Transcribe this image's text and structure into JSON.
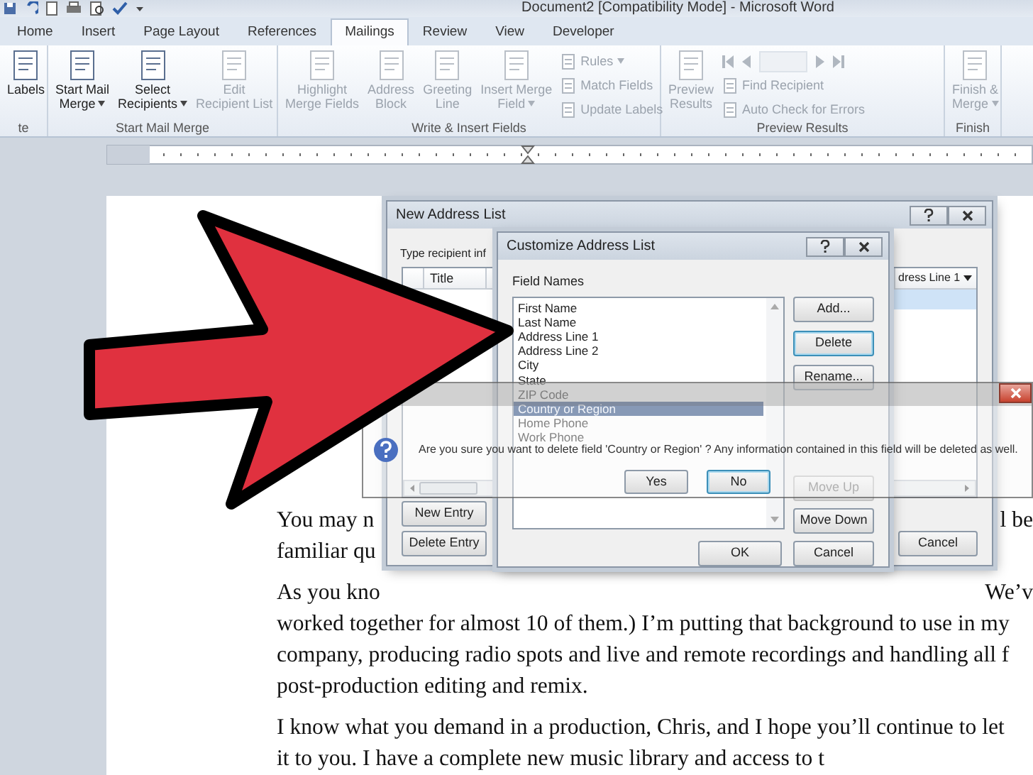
{
  "window": {
    "title": "Document2 [Compatibility Mode]  -  Microsoft Word"
  },
  "ribbon_tabs": [
    {
      "label": "Home",
      "selected": false
    },
    {
      "label": "Insert",
      "selected": false
    },
    {
      "label": "Page Layout",
      "selected": false
    },
    {
      "label": "References",
      "selected": false
    },
    {
      "label": "Mailings",
      "selected": true
    },
    {
      "label": "Review",
      "selected": false
    },
    {
      "label": "View",
      "selected": false
    },
    {
      "label": "Developer",
      "selected": false
    }
  ],
  "ribbon_groups": [
    {
      "label": "te",
      "items": [
        {
          "kind": "large",
          "lines": [
            "Labels"
          ],
          "dropdown": false,
          "disabled": false
        }
      ]
    },
    {
      "label": "Start Mail Merge",
      "items": [
        {
          "kind": "large",
          "lines": [
            "Start Mail",
            "Merge"
          ],
          "dropdown": true,
          "disabled": false
        },
        {
          "kind": "large",
          "lines": [
            "Select",
            "Recipients"
          ],
          "dropdown": true,
          "disabled": false
        },
        {
          "kind": "large",
          "lines": [
            "Edit",
            "Recipient List"
          ],
          "dropdown": false,
          "disabled": true
        }
      ]
    },
    {
      "label": "Write & Insert Fields",
      "items": [
        {
          "kind": "large",
          "lines": [
            "Highlight",
            "Merge Fields"
          ],
          "dropdown": false,
          "disabled": true
        },
        {
          "kind": "large",
          "lines": [
            "Address",
            "Block"
          ],
          "dropdown": false,
          "disabled": true
        },
        {
          "kind": "large",
          "lines": [
            "Greeting",
            "Line"
          ],
          "dropdown": false,
          "disabled": true
        },
        {
          "kind": "large",
          "lines": [
            "Insert Merge",
            "Field"
          ],
          "dropdown": true,
          "disabled": true
        },
        {
          "kind": "stack",
          "rows": [
            {
              "kind": "button",
              "label": "Rules",
              "dropdown": true,
              "disabled": true
            },
            {
              "kind": "button",
              "label": "Match Fields",
              "dropdown": false,
              "disabled": true
            },
            {
              "kind": "button",
              "label": "Update Labels",
              "dropdown": false,
              "disabled": true
            }
          ]
        }
      ]
    },
    {
      "label": "Preview Results",
      "items": [
        {
          "kind": "large",
          "lines": [
            "Preview",
            "Results"
          ],
          "dropdown": false,
          "disabled": true
        },
        {
          "kind": "stack",
          "rows": [
            {
              "kind": "nav",
              "disabled": true
            },
            {
              "kind": "button",
              "label": "Find Recipient",
              "dropdown": false,
              "disabled": true
            },
            {
              "kind": "button",
              "label": "Auto Check for Errors",
              "dropdown": false,
              "disabled": true
            }
          ]
        }
      ]
    },
    {
      "label": "Finish",
      "items": [
        {
          "kind": "large",
          "lines": [
            "Finish &",
            "Merge"
          ],
          "dropdown": true,
          "disabled": true
        }
      ]
    }
  ],
  "document": {
    "paragraphs": [
      {
        "lines": [
          {
            "left": "You may n",
            "right": "l be"
          },
          {
            "left": "familiar qu"
          }
        ]
      },
      {
        "lines": [
          {
            "left": "As you kno",
            "right": "We’v"
          },
          {
            "left": "worked together for almost 10 of them.) I’m putting that background to use in my"
          },
          {
            "left": "company, producing radio spots and live and remote recordings and handling all f"
          },
          {
            "left": "post-production editing and remix."
          }
        ]
      },
      {
        "lines": [
          {
            "left": "I know what you demand in a production, Chris, and I hope you’ll continue to let"
          },
          {
            "left": "it to you. I have a complete new music library and access to t"
          }
        ]
      }
    ]
  },
  "new_address_list": {
    "title": "New Address List",
    "prompt": "Type recipient inf",
    "table": {
      "columns": [
        "Title",
        "dress Line 1"
      ],
      "rows": [
        {
          "selected": true
        }
      ]
    },
    "buttons": [
      "New Entry",
      "Delete Entry",
      "Cancel"
    ]
  },
  "customize_address_list": {
    "title": "Customize Address List",
    "list_label": "Field Names",
    "fields": [
      {
        "name": "First Name",
        "selected": false
      },
      {
        "name": "Last Name",
        "selected": false
      },
      {
        "name": "Address Line 1",
        "selected": false
      },
      {
        "name": "Address Line 2",
        "selected": false
      },
      {
        "name": "City",
        "selected": false
      },
      {
        "name": "State",
        "selected": false
      },
      {
        "name": "ZIP Code",
        "selected": false
      },
      {
        "name": "Country or Region",
        "selected": true
      },
      {
        "name": "Home Phone",
        "selected": false
      },
      {
        "name": "Work Phone",
        "selected": false
      }
    ],
    "side_buttons": [
      {
        "label": "Add...",
        "focused": false,
        "disabled": false
      },
      {
        "label": "Delete",
        "focused": true,
        "disabled": false
      },
      {
        "label": "Rename...",
        "focused": false,
        "disabled": false
      },
      {
        "label": "Move Up",
        "focused": false,
        "disabled": true
      },
      {
        "label": "Move Down",
        "focused": false,
        "disabled": false
      }
    ],
    "buttons": [
      "OK",
      "Cancel"
    ]
  },
  "confirm": {
    "message": "Are you sure you want to delete field 'Country or Region' ? Any information contained in this field will be deleted as well.",
    "buttons": [
      {
        "label": "Yes",
        "focused": false
      },
      {
        "label": "No",
        "focused": true
      }
    ]
  }
}
